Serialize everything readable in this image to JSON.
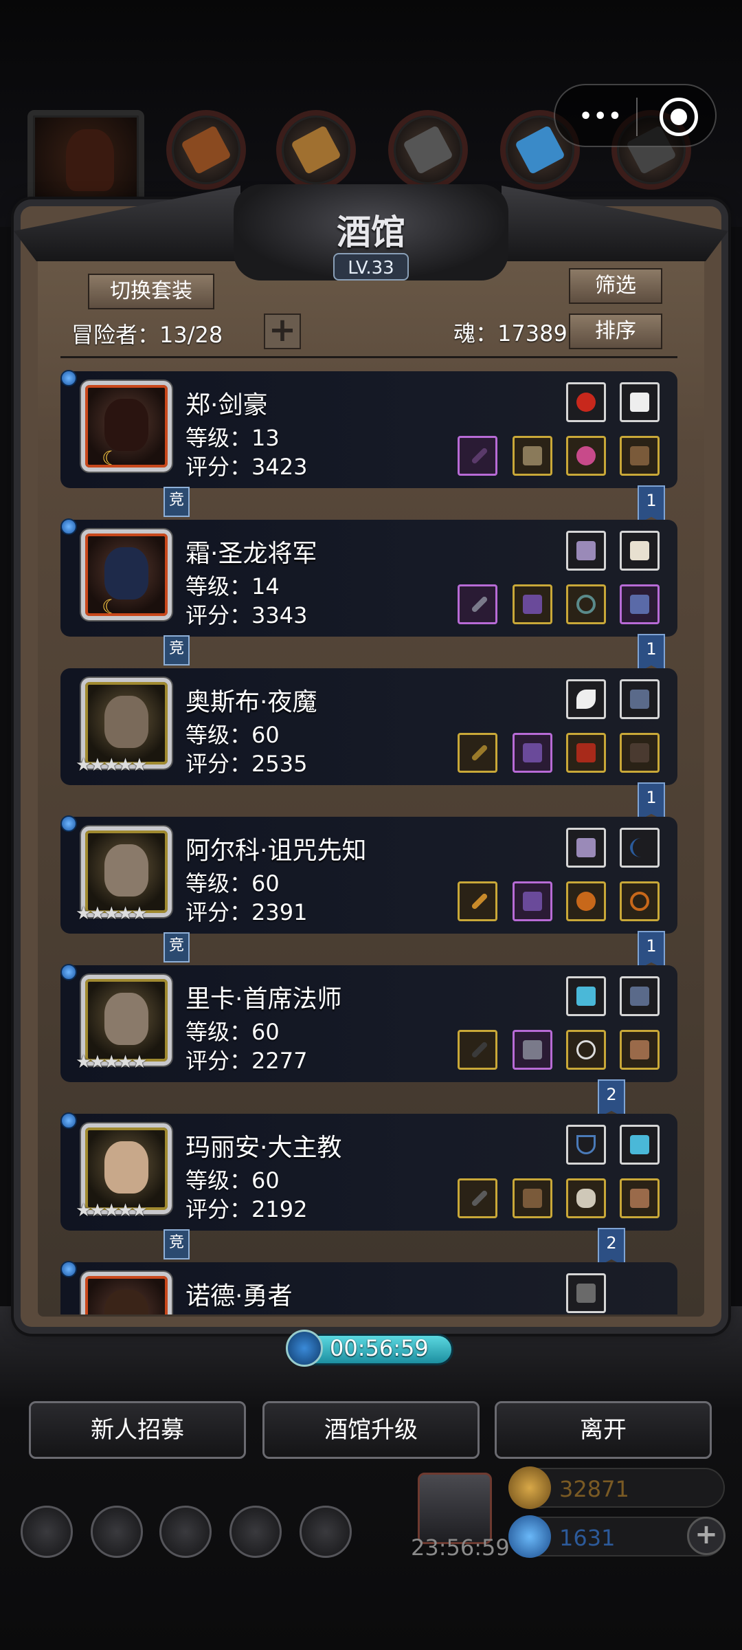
{
  "panel": {
    "title": "酒馆",
    "level": "LV.33",
    "switch_outfit": "切换套装",
    "filter": "筛选",
    "sort": "排序",
    "adventurers_label": "冒险者：13/28",
    "soul_label": "魂：17389",
    "plus_symbol": "+"
  },
  "capsule": {
    "more": "•••"
  },
  "heroes": [
    {
      "name": "郑·剑豪",
      "level": "等级：13",
      "score": "评分：3423",
      "frame": "red",
      "competitive": "竞",
      "flag": "1"
    },
    {
      "name": "霜·圣龙将军",
      "level": "等级：14",
      "score": "评分：3343",
      "frame": "red",
      "competitive": "竞",
      "flag": "1"
    },
    {
      "name": "奥斯布·夜魔",
      "level": "等级：60",
      "score": "评分：2535",
      "frame": "gold",
      "stars": "★★★★★",
      "flag": "1"
    },
    {
      "name": "阿尔科·诅咒先知",
      "level": "等级：60",
      "score": "评分：2391",
      "frame": "gold",
      "stars": "★★★★★",
      "competitive": "竞",
      "flag": "1"
    },
    {
      "name": "里卡·首席法师",
      "level": "等级：60",
      "score": "评分：2277",
      "frame": "gold",
      "stars": "★★★★★",
      "flag": "2"
    },
    {
      "name": "玛丽安·大主教",
      "level": "等级：60",
      "score": "评分：2192",
      "frame": "gold",
      "stars": "★★★★★",
      "competitive": "竞",
      "flag": "2"
    },
    {
      "name": "诺德·勇者",
      "frame": "red"
    }
  ],
  "moon_symbol": "☾",
  "timer": "00:56:59",
  "buttons": {
    "recruit": "新人招募",
    "upgrade": "酒馆升级",
    "leave": "离开"
  },
  "gift_timer": "23:56:59",
  "resources": {
    "gold": "32871",
    "gems": "1631"
  },
  "colors": {
    "gold_text": "#7a5a24",
    "gem_text": "#2c5a9a"
  }
}
